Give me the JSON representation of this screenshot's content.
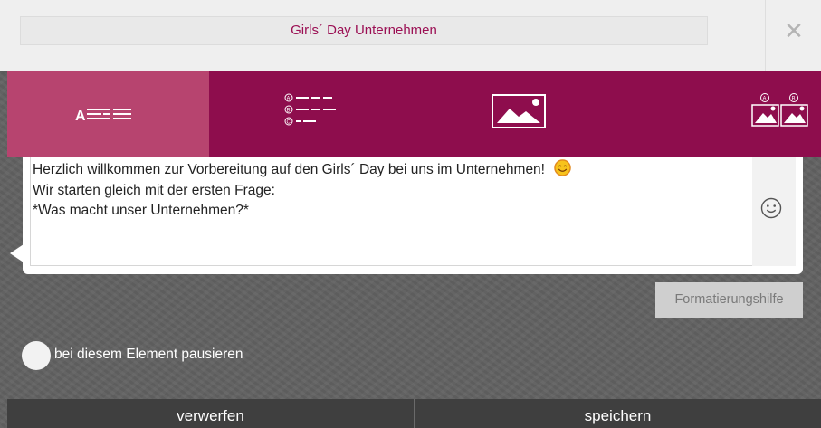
{
  "header": {
    "title": "Girls´ Day Unternehmen",
    "close_icon": "close-icon"
  },
  "toolbar": {
    "buttons": [
      {
        "name": "text-format-icon",
        "glyph": "A",
        "active": true
      },
      {
        "name": "multiple-choice-icon",
        "options": [
          "A",
          "B",
          "C"
        ],
        "active": false
      },
      {
        "name": "image-icon",
        "active": false
      },
      {
        "name": "image-choice-icon",
        "options": [
          "A",
          "B"
        ],
        "active": false
      }
    ],
    "colors": {
      "bar": "#8e0d4d",
      "active": "#b7446f"
    }
  },
  "editor": {
    "lines": [
      "Herzlich willkommen zur Vorbereitung auf den Girls´ Day bei uns im Unternehmen!",
      "Wir starten gleich mit der ersten Frage:",
      "*Was macht unser Unternehmen?*"
    ],
    "inline_emoji": "smiling-face-emoji",
    "emoji_button_icon": "smiley-icon"
  },
  "format_help_label": "Formatierungshilfe",
  "pause": {
    "label": "bei diesem Element pausieren",
    "enabled": false
  },
  "footer": {
    "discard_label": "verwerfen",
    "save_label": "speichern"
  }
}
